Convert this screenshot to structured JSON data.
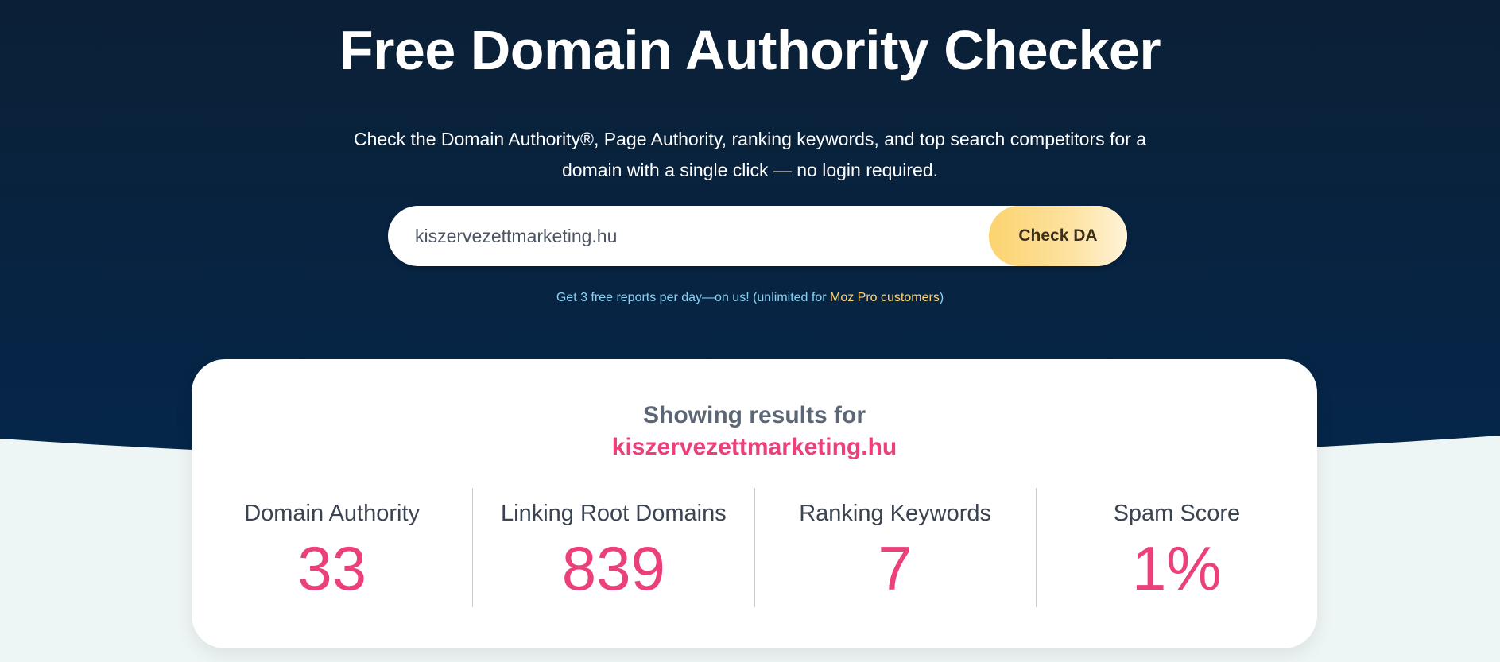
{
  "hero": {
    "title": "Free Domain Authority Checker",
    "subtitle": "Check the Domain Authority®, Page Authority, ranking keywords, and top search competitors for a domain with a single click — no login required."
  },
  "search": {
    "value": "kiszervezettmarketing.hu",
    "placeholder": "",
    "button_label": "Check DA"
  },
  "free_note": {
    "prefix": "Get 3 free reports per day—on us! (unlimited for ",
    "link_label": "Moz Pro customers",
    "suffix": ")"
  },
  "results": {
    "heading": "Showing results for",
    "domain": "kiszervezettmarketing.hu",
    "metrics": [
      {
        "label": "Domain Authority",
        "value": "33"
      },
      {
        "label": "Linking Root Domains",
        "value": "839"
      },
      {
        "label": "Ranking Keywords",
        "value": "7"
      },
      {
        "label": "Spam Score",
        "value": "1%"
      }
    ]
  },
  "colors": {
    "hero_top": "#0b2036",
    "hero_bottom": "#05264a",
    "accent_pink": "#ec407a",
    "button_yellow": "#fcd36f",
    "note_blue": "#8ad2f4",
    "page_bg": "#eef5f5"
  }
}
